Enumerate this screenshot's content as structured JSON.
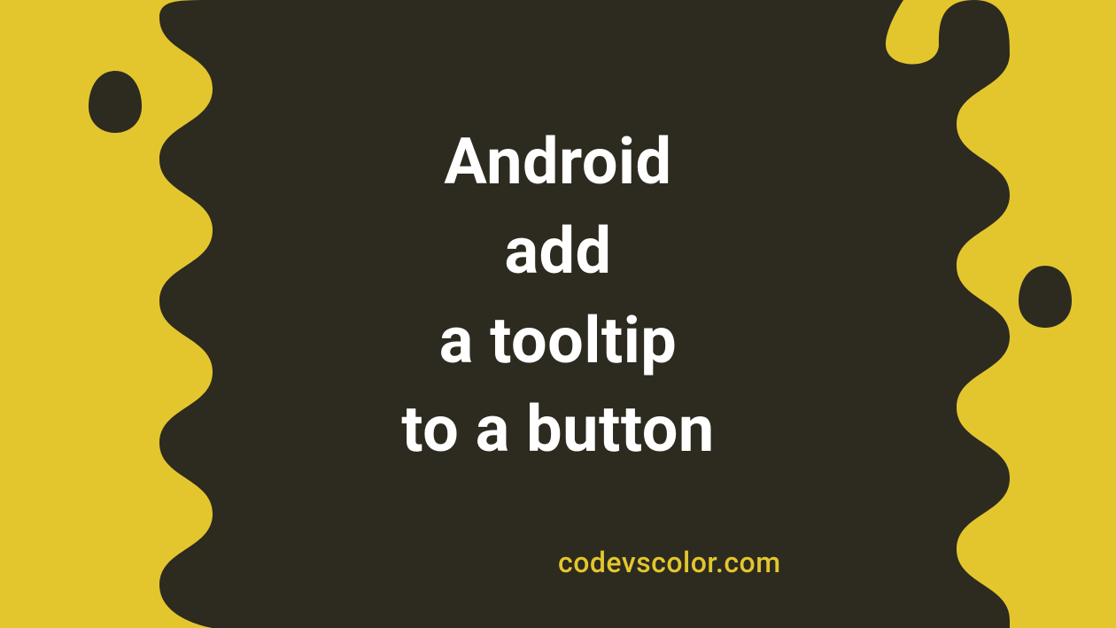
{
  "title": {
    "line1": "Android",
    "line2": "add",
    "line3": "a tooltip",
    "line4": "to a button"
  },
  "attribution": "codevscolor.com",
  "colors": {
    "background": "#e3c62e",
    "blob": "#2d2a1f",
    "titleText": "#ffffff",
    "attributionText": "#e3c62e"
  }
}
